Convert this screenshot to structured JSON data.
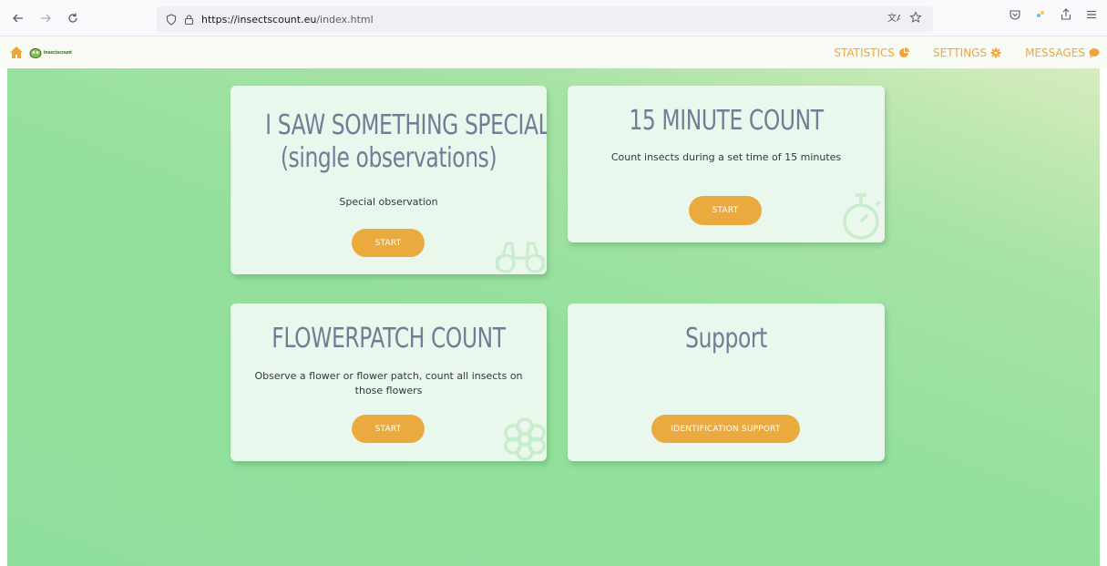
{
  "browser": {
    "url_host": "https://insectscount.eu",
    "url_path": "/index.html"
  },
  "header": {
    "logo_text": "insectscount",
    "nav": [
      {
        "label": "STATISTICS",
        "icon": "pie-chart-icon"
      },
      {
        "label": "SETTINGS",
        "icon": "gear-icon"
      },
      {
        "label": "MESSAGES",
        "icon": "speech-bubble-icon"
      }
    ]
  },
  "cards": {
    "special": {
      "title_line1": "I SAW SOMETHING SPECIAL",
      "title_line2": "(single observations)",
      "description": "Special observation",
      "button": "START",
      "icon": "binoculars-icon"
    },
    "count15": {
      "title": "15 MINUTE COUNT",
      "description": "Count insects during a set time of 15 minutes",
      "button": "START",
      "icon": "stopwatch-icon"
    },
    "flowerpatch": {
      "title": "FLOWERPATCH COUNT",
      "description_line1": "Observe a flower or flower patch, count all insects on",
      "description_line2": "those flowers",
      "button": "START",
      "icon": "flower-icon"
    },
    "support": {
      "title": "Support",
      "button": "IDENTIFICATION SUPPORT"
    }
  },
  "colors": {
    "accent": "#eaaa3e",
    "nav_text": "#f0a53a",
    "card_bg": "#eaf7ec",
    "title_text": "#6f7d96"
  }
}
